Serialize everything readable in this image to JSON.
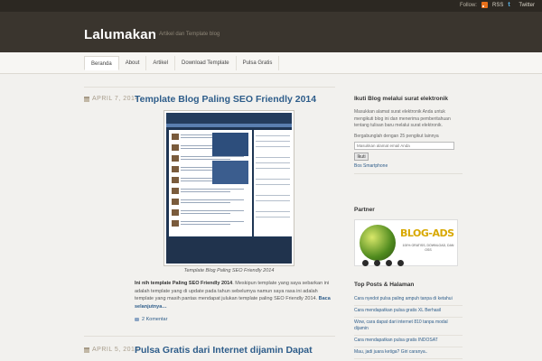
{
  "topbar": {
    "follow_label": "Follow:",
    "rss_label": "RSS",
    "twitter_label": "Twitter",
    "rss_icon": "rss-icon",
    "twitter_icon": "twitter-icon"
  },
  "header": {
    "title": "Lalumakan",
    "tagline": "Artikel dan Template blog"
  },
  "nav": {
    "items": [
      {
        "label": "Beranda",
        "active": true
      },
      {
        "label": "About",
        "active": false
      },
      {
        "label": "Artikel",
        "active": false
      },
      {
        "label": "Download Template",
        "active": false
      },
      {
        "label": "Pulsa Gratis",
        "active": false
      }
    ]
  },
  "posts": [
    {
      "date": "APRIL 7, 2014",
      "title": "Template Blog Paling SEO Friendly 2014",
      "caption": "Template Blog Paling SEO Friendly 2014",
      "excerpt_bold": "Ini nih template Paling SEO Friendly 2014",
      "excerpt": ". Meskipun template yang saya sebarkan ini adalah template yang di update pada tahun sebelumya namun saya rasa ini adalah template yang masih pantas mendapat julukan template paling SEO Friendly 2014.",
      "read_more": "Baca selanjutnya…",
      "comments": "2 Komentar"
    },
    {
      "date": "APRIL 5, 2014",
      "title": "Pulsa Gratis dari Internet dijamin Dapat"
    }
  ],
  "sidebar": {
    "subscribe": {
      "heading": "Ikuti Blog melalui surat elektronik",
      "text": "Masukkan alamat surat elektronik Anda untuk mengikuti blog ini dan menerima pemberitahuan tentang tulisan baru melalui surat elektronik.",
      "count_text": "Bergabunglah dengan 25 pengikut lainnya",
      "placeholder": "Masukkan alamat email Anda",
      "button": "Ikuti",
      "link": "Bos Smartphone"
    },
    "partner": {
      "heading": "Partner",
      "ads_title": "BLOG-ADS",
      "ads_sub": "100% GRATISS, DOWNLOAD, DAN OSS"
    },
    "top_posts": {
      "heading": "Top Posts & Halaman",
      "items": [
        "Cara nyedot pulsa paling ampuh tanpa di ketahui",
        "Cara mendapatkan pulsa gratis XL Berhasil",
        "Wow, cara dapat dari internet 810 tanpa modal dijamin",
        "Cara mendapatkan pulsa gratis INDOSAT",
        "Mau, jadi juara ketiga? Giri caranya.."
      ]
    }
  },
  "colors": {
    "topbar": "#2c2822",
    "header": "#3a352e",
    "link": "#2e5d8a",
    "date": "#a89d8c"
  }
}
